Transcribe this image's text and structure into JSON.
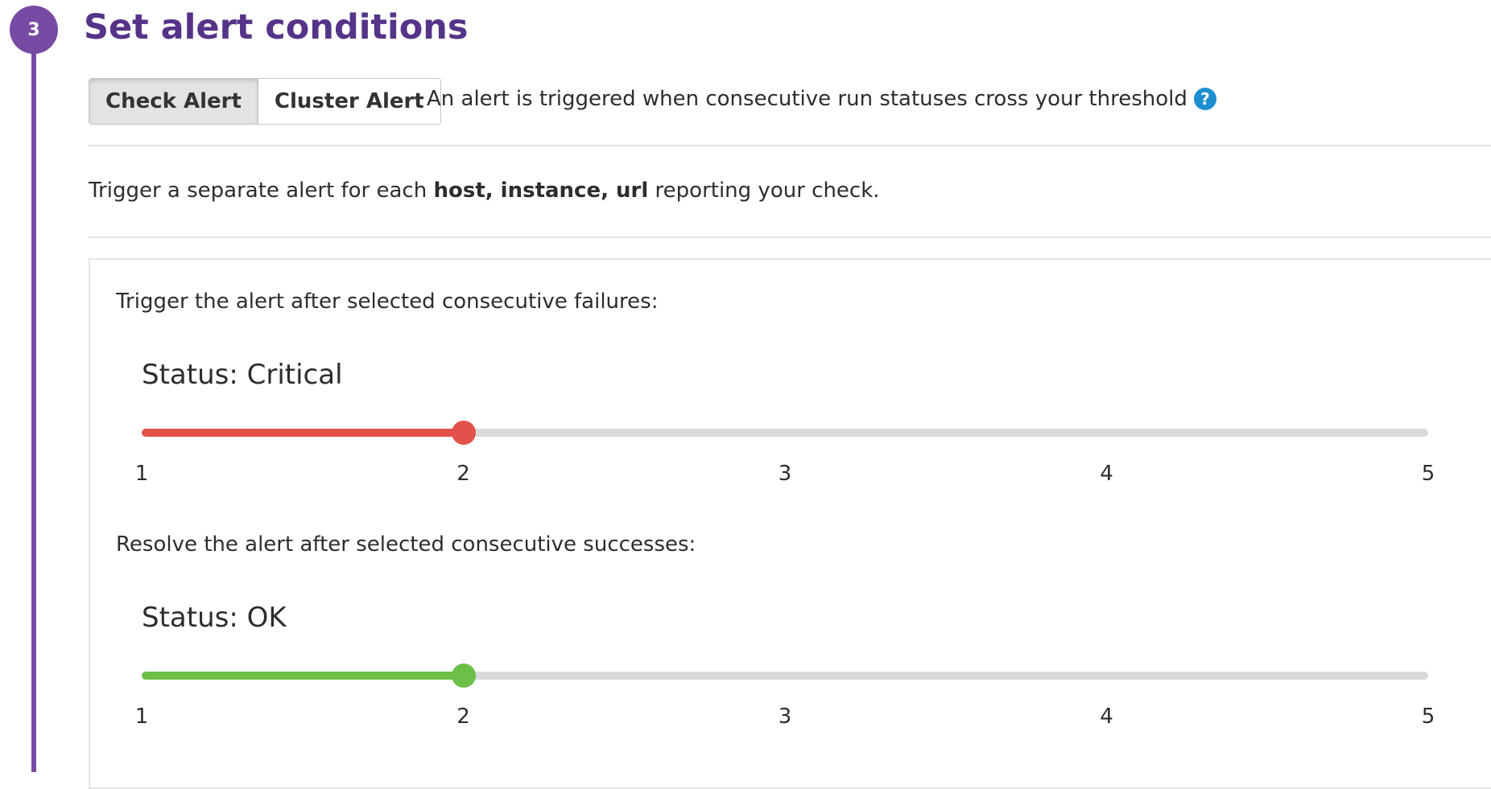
{
  "step": {
    "number": "3",
    "title": "Set alert conditions"
  },
  "alert_type": {
    "options": [
      "Check Alert",
      "Cluster Alert"
    ],
    "selected": "Check Alert",
    "description": "An alert is triggered when consecutive run statuses cross your threshold",
    "help_glyph": "?",
    "help_icon": "question-circle-icon"
  },
  "separate_alert": {
    "prefix": "Trigger a separate alert for each",
    "tags": "host, instance, url",
    "suffix": "reporting your check."
  },
  "thresholds": [
    {
      "prompt": "Trigger the alert after selected consecutive failures:",
      "status_label": "Status: Critical",
      "min": 1,
      "max": 5,
      "value": 2,
      "ticks": [
        "1",
        "2",
        "3",
        "4",
        "5"
      ],
      "color": "#e2514a"
    },
    {
      "prompt": "Resolve the alert after selected consecutive successes:",
      "status_label": "Status: OK",
      "min": 1,
      "max": 5,
      "value": 2,
      "ticks": [
        "1",
        "2",
        "3",
        "4",
        "5"
      ],
      "color": "#6cbf47"
    }
  ],
  "colors": {
    "accent": "#774aa4",
    "title": "#553388",
    "help": "#1d8ed0"
  }
}
